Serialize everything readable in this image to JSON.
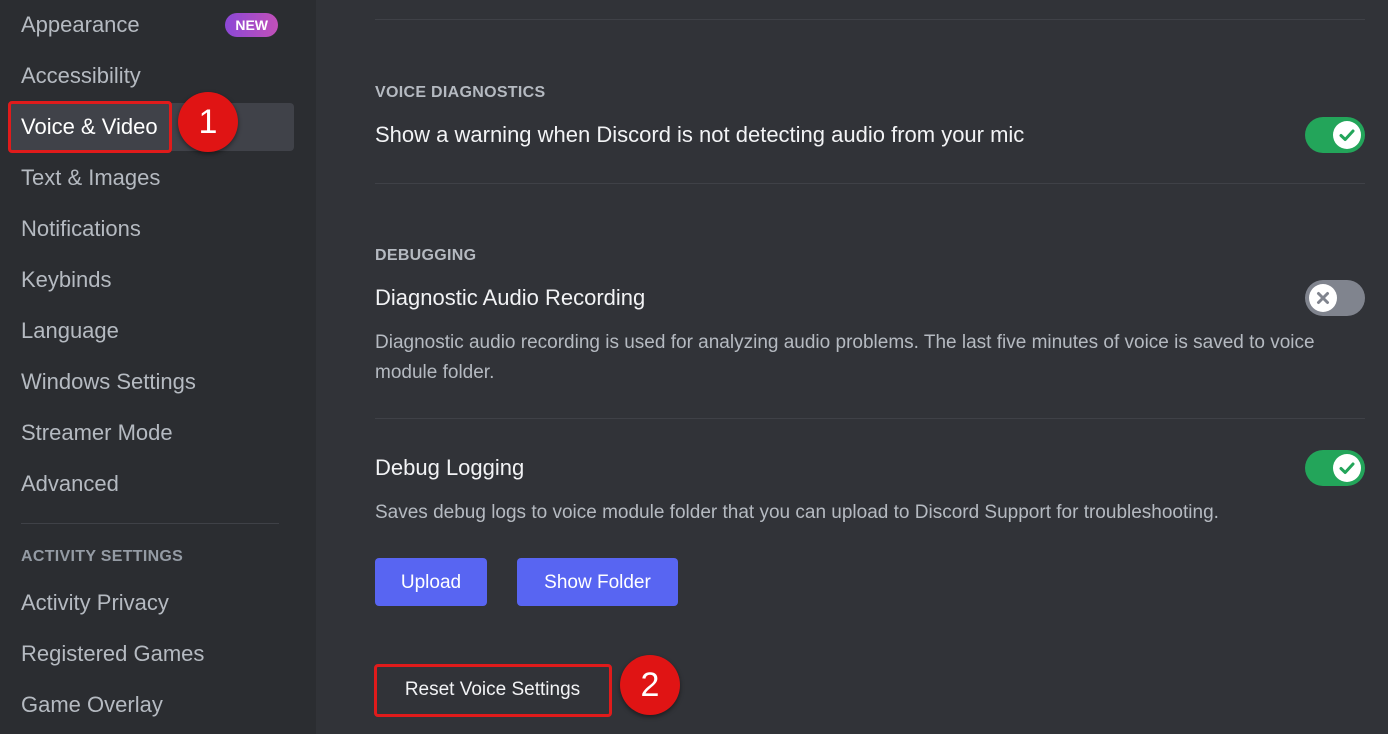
{
  "sidebar": {
    "items": [
      {
        "label": "Appearance",
        "badge": "NEW"
      },
      {
        "label": "Accessibility"
      },
      {
        "label": "Voice & Video",
        "selected": true
      },
      {
        "label": "Text & Images"
      },
      {
        "label": "Notifications"
      },
      {
        "label": "Keybinds"
      },
      {
        "label": "Language"
      },
      {
        "label": "Windows Settings"
      },
      {
        "label": "Streamer Mode"
      },
      {
        "label": "Advanced"
      }
    ],
    "activity_header": "ACTIVITY SETTINGS",
    "activity_items": [
      {
        "label": "Activity Privacy"
      },
      {
        "label": "Registered Games"
      },
      {
        "label": "Game Overlay"
      }
    ]
  },
  "main": {
    "voice_diagnostics": {
      "section_title": "VOICE DIAGNOSTICS",
      "setting_title": "Show a warning when Discord is not detecting audio from your mic",
      "enabled": true
    },
    "debugging": {
      "section_title": "DEBUGGING",
      "diagnostic_recording": {
        "title": "Diagnostic Audio Recording",
        "description": "Diagnostic audio recording is used for analyzing audio problems. The last five minutes of voice is saved to voice module folder.",
        "enabled": false
      },
      "debug_logging": {
        "title": "Debug Logging",
        "description": "Saves debug logs to voice module folder that you can upload to Discord Support for troubleshooting.",
        "enabled": true
      },
      "upload_label": "Upload",
      "show_folder_label": "Show Folder"
    },
    "reset_label": "Reset Voice Settings"
  },
  "annotations": {
    "step1": "1",
    "step2": "2"
  },
  "colors": {
    "accent": "#5865f2",
    "toggle_on": "#23a55a",
    "toggle_off": "#80848e",
    "callout": "#e01414"
  }
}
